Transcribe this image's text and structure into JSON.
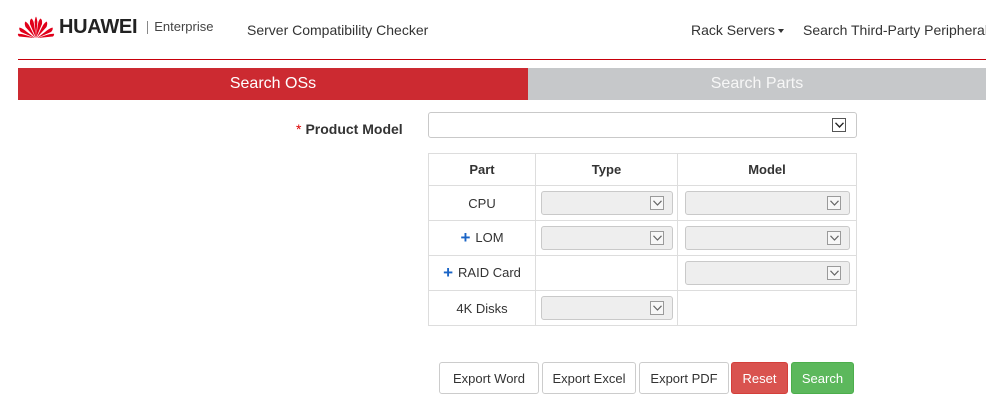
{
  "header": {
    "brand": "HUAWEI",
    "brand_sub": "Enterprise",
    "app_title": "Server Compatibility Checker",
    "nav": {
      "rack_servers": "Rack Servers",
      "third_party": "Search Third-Party Peripheral"
    },
    "accent_color": "#c7000b"
  },
  "tabs": {
    "search_os": "Search OSs",
    "search_parts": "Search Parts",
    "active": "search_os"
  },
  "form": {
    "product_model_required": "*",
    "product_model_label": "Product Model",
    "product_model_value": ""
  },
  "table": {
    "headers": {
      "part": "Part",
      "type": "Type",
      "model": "Model"
    },
    "rows": {
      "cpu": "CPU",
      "lom": "LOM",
      "raid": "RAID Card",
      "disks": "4K Disks"
    },
    "expand_symbol": "+"
  },
  "buttons": {
    "export_word": "Export Word",
    "export_excel": "Export Excel",
    "export_pdf": "Export PDF",
    "reset": "Reset",
    "search": "Search"
  },
  "colors": {
    "tab_active": "#cc2a31",
    "tab_inactive": "#c6c8ca",
    "reset": "#d9534f",
    "search": "#5cb85c",
    "plus": "#1a64c6"
  }
}
